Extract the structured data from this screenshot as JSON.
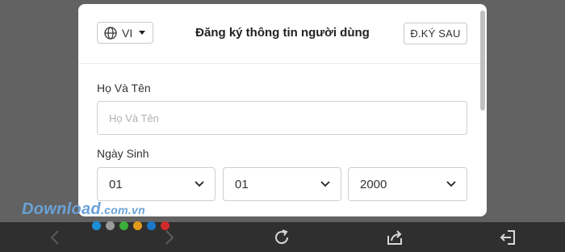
{
  "header": {
    "language_label": "VI",
    "title": "Đăng ký thông tin người dùng",
    "skip_label": "Đ.KÝ SAU"
  },
  "form": {
    "name_label": "Họ Và Tên",
    "name_placeholder": "Họ Và Tên",
    "name_value": "",
    "dob_label": "Ngày Sinh",
    "day": "01",
    "month": "01",
    "year": "2000"
  },
  "watermark": {
    "text": "Download",
    "domain": ".com.vn"
  },
  "page_dots": [
    "#1a8fd8",
    "#9a9a9a",
    "#3cae3c",
    "#e29a1a",
    "#1a78c8",
    "#d02a2a"
  ],
  "icons": {
    "language": "globe-icon",
    "back": "chevron-left-icon",
    "forward": "chevron-right-icon",
    "reload": "refresh-icon",
    "share": "share-icon",
    "exit": "exit-icon"
  },
  "colors": {
    "backdrop": "#626262",
    "toolbar": "#2f2f2f",
    "modal": "#ffffff"
  }
}
